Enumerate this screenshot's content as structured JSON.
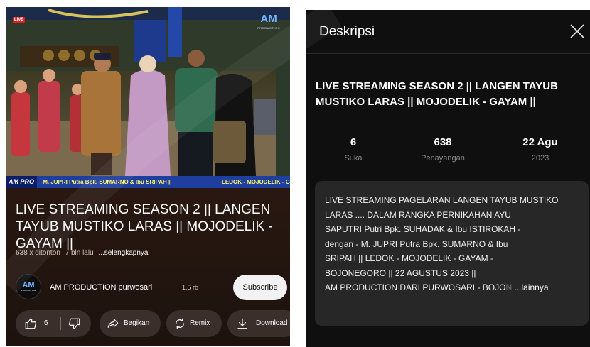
{
  "player": {
    "live_badge": "LIVE",
    "overlay_logo": "AM",
    "overlay_logo_sub": "PRODUCTION",
    "ticker_tag": "AM PRO",
    "ticker_text": "M. JUPRI Putra Bpk. SUMARNO  &  Ibu SRIPAH   ||",
    "ticker_text_right": "LEDOK - MOJODELIK - GAYA"
  },
  "video": {
    "title": "LIVE STREAMING SEASON 2  || LANGEN TAYUB MUSTIKO LARAS  || MOJODELIK - GAYAM ||",
    "views": "638 x ditonton",
    "age": "7 bln lalu",
    "more": "...selengkapnya"
  },
  "channel": {
    "avatar_text": "AM",
    "avatar_sub": "PRODUCTION",
    "name": "AM PRODUCTION purwosari",
    "subscribers": "1,5 rb",
    "subscribe_label": "Subscribe"
  },
  "actions": {
    "like_count": "6",
    "share_label": "Bagikan",
    "remix_label": "Remix",
    "download_label": "Download"
  },
  "description_panel": {
    "header": "Deskripsi",
    "title": "LIVE STREAMING SEASON 2  || LANGEN TAYUB MUSTIKO LARAS  || MOJODELIK - GAYAM ||",
    "stats": [
      {
        "value": "6",
        "label": "Suka"
      },
      {
        "value": "638",
        "label": "Penayangan"
      },
      {
        "value": "22 Agu",
        "label": "2023"
      }
    ],
    "body_lines": [
      "LIVE STREAMING  PAGELARAN LANGEN TAYUB MUSTIKO",
      "LARAS        ....         DALAM RANGKA PERNIKAHAN       AYU",
      "SAPUTRI  Putri Bpk. SUHADAK &  Ibu ISTIROKAH          -",
      "dengan -              M. JUPRI Putra Bpk. SUMARNO  &  Ibu",
      "SRIPAH       ||                LEDOK - MOJODELIK - GAYAM -",
      "BOJONEGORO             ||          22 AGUSTUS 2023          ||",
      "AM PRODUCTION    DARI PURWOSARI - BOJO"
    ],
    "fade_text": "N",
    "more": "...lainnya"
  },
  "icons": {
    "close": "close-icon",
    "like": "thumbs-up-icon",
    "dislike": "thumbs-down-icon",
    "share": "share-icon",
    "remix": "remix-icon",
    "download": "download-icon"
  }
}
